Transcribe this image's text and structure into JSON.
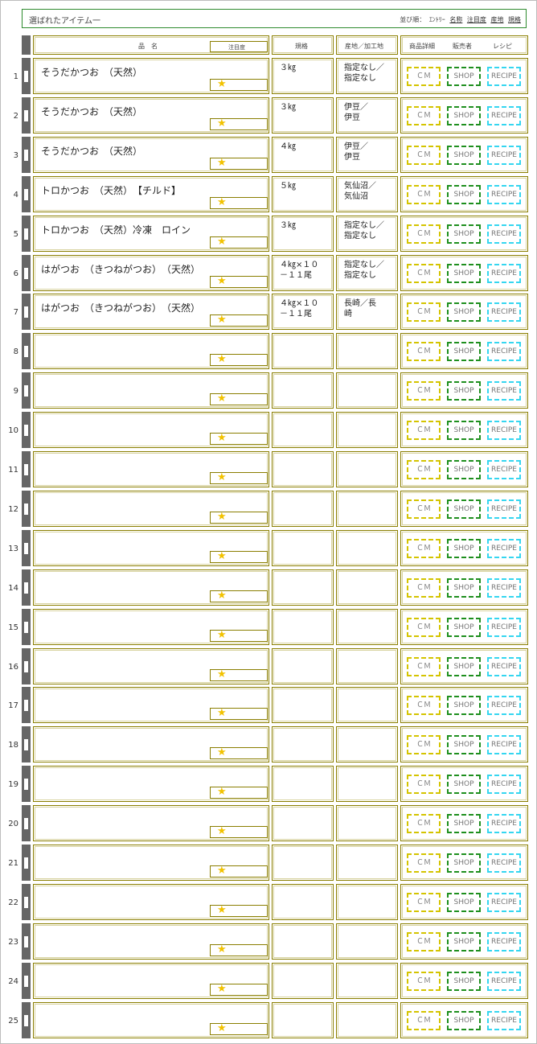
{
  "header": {
    "title": "選ばれたアイテム一",
    "sort": {
      "label": "並び順：",
      "entry": "ｴﾝﾄﾘｰ",
      "links": [
        "名称",
        "注目度",
        "産地",
        "規格"
      ]
    }
  },
  "columns": {
    "name": "品　名",
    "attention": "注目度",
    "spec": "規格",
    "origin": "産地／加工地",
    "detail": "商品詳細",
    "seller": "販売者",
    "recipe": "レシピ"
  },
  "buttons": {
    "cm": "ＣＭ",
    "shop": "SHOP",
    "recipe": "RECIPE"
  },
  "star": "★",
  "rows": [
    {
      "num": "1",
      "name": "そうだかつお　（天然）",
      "spec": "３㎏",
      "origin": "指定なし／\n指定なし"
    },
    {
      "num": "2",
      "name": "そうだかつお　（天然）",
      "spec": "３㎏",
      "origin": "伊豆／\n伊豆"
    },
    {
      "num": "3",
      "name": "そうだかつお　（天然）",
      "spec": "４㎏",
      "origin": "伊豆／\n伊豆"
    },
    {
      "num": "4",
      "name": "トロかつお　（天然）　【チルド】",
      "spec": "５㎏",
      "origin": "気仙沼／\n気仙沼"
    },
    {
      "num": "5",
      "name": "トロかつお　（天然）冷凍　ロイン",
      "spec": "３㎏",
      "origin": "指定なし／\n指定なし"
    },
    {
      "num": "6",
      "name": "はがつお　（きつねがつお）　（天然）",
      "spec": "４㎏×１０\n－１１尾",
      "origin": "指定なし／\n指定なし"
    },
    {
      "num": "7",
      "name": "はがつお　（きつねがつお）　（天然）",
      "spec": "４㎏×１０\n－１１尾",
      "origin": "長崎／長\n崎"
    },
    {
      "num": "8",
      "name": "",
      "spec": "",
      "origin": ""
    },
    {
      "num": "9",
      "name": "",
      "spec": "",
      "origin": ""
    },
    {
      "num": "10",
      "name": "",
      "spec": "",
      "origin": ""
    },
    {
      "num": "11",
      "name": "",
      "spec": "",
      "origin": ""
    },
    {
      "num": "12",
      "name": "",
      "spec": "",
      "origin": ""
    },
    {
      "num": "13",
      "name": "",
      "spec": "",
      "origin": ""
    },
    {
      "num": "14",
      "name": "",
      "spec": "",
      "origin": ""
    },
    {
      "num": "15",
      "name": "",
      "spec": "",
      "origin": ""
    },
    {
      "num": "16",
      "name": "",
      "spec": "",
      "origin": ""
    },
    {
      "num": "17",
      "name": "",
      "spec": "",
      "origin": ""
    },
    {
      "num": "18",
      "name": "",
      "spec": "",
      "origin": ""
    },
    {
      "num": "19",
      "name": "",
      "spec": "",
      "origin": ""
    },
    {
      "num": "20",
      "name": "",
      "spec": "",
      "origin": ""
    },
    {
      "num": "21",
      "name": "",
      "spec": "",
      "origin": ""
    },
    {
      "num": "22",
      "name": "",
      "spec": "",
      "origin": ""
    },
    {
      "num": "23",
      "name": "",
      "spec": "",
      "origin": ""
    },
    {
      "num": "24",
      "name": "",
      "spec": "",
      "origin": ""
    },
    {
      "num": "25",
      "name": "",
      "spec": "",
      "origin": ""
    }
  ]
}
